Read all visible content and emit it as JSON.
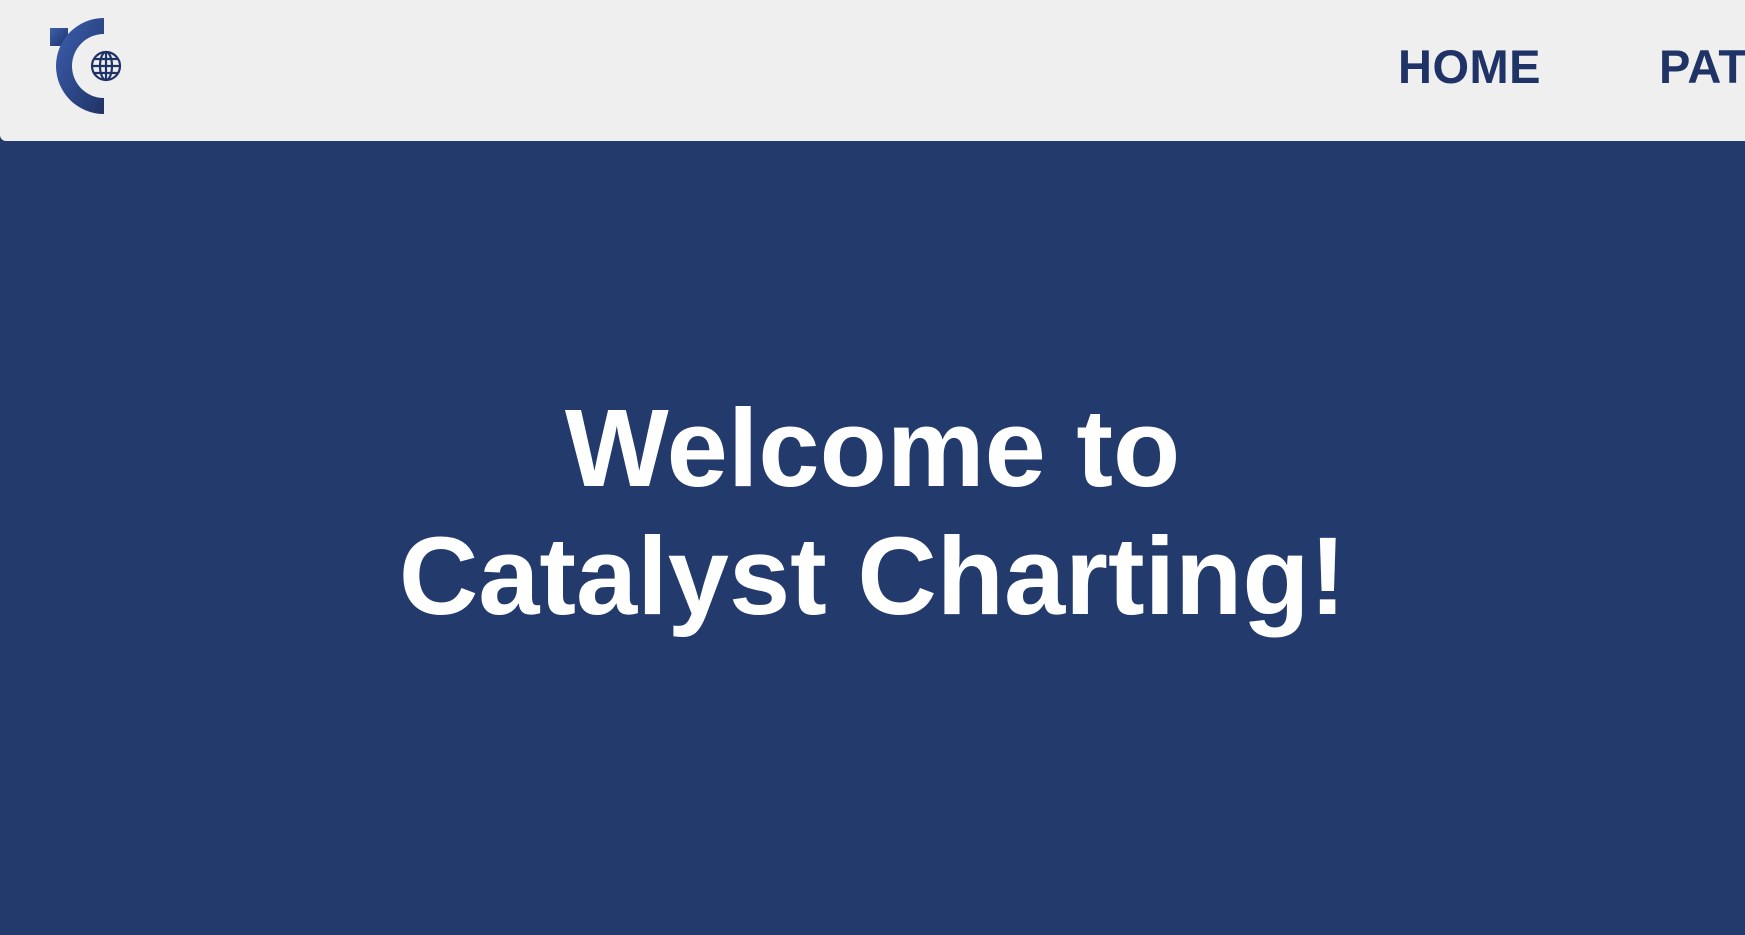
{
  "header": {
    "logo": {
      "icon": "catalyst-charting-logo-globe",
      "colors": {
        "primary": "#2e4c96",
        "dark": "#1f3366"
      }
    },
    "nav": [
      {
        "label": "HOME"
      },
      {
        "label": "PAT"
      }
    ]
  },
  "hero": {
    "title_line1": "Welcome to",
    "title_line2": "Catalyst Charting!",
    "background_color": "#233a6c",
    "text_color": "#ffffff"
  }
}
